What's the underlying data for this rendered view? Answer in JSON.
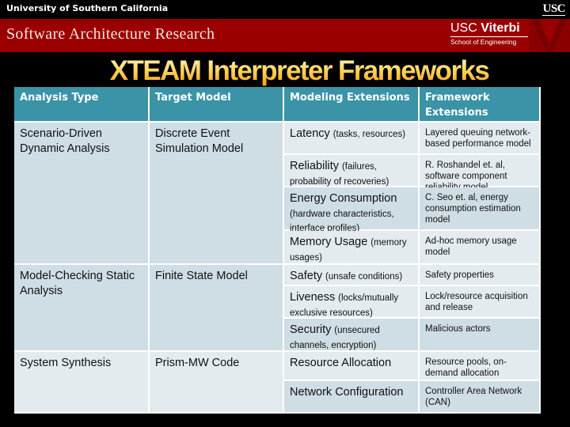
{
  "header": {
    "university": "University of Southern California",
    "usc_logo": "USC",
    "banner_title": "Software Architecture Research",
    "viterbi_line1_usc": "USC",
    "viterbi_line1_name": "Viterbi",
    "viterbi_line2": "School of Engineering"
  },
  "slide": {
    "title": "XTEAM Interpreter Frameworks"
  },
  "table": {
    "headers": [
      "Analysis Type",
      "Target Model",
      "Modeling Extensions",
      "Framework Extensions"
    ],
    "groups": [
      {
        "analysis_type": "Scenario-Driven Dynamic Analysis",
        "target_model": "Discrete Event Simulation Model",
        "rows": [
          {
            "ext_main": "Latency",
            "ext_detail": "(tasks, resources)",
            "framework": "Layered queuing network-based performance model"
          },
          {
            "ext_main": "Reliability",
            "ext_detail": "(failures, probability of recoveries)",
            "framework": "R. Roshandel et. al, software component reliability model"
          },
          {
            "ext_main": "Energy Consumption",
            "ext_detail": "(hardware characteristics, interface profiles)",
            "framework": "C. Seo et. al, energy consumption estimation model"
          },
          {
            "ext_main": "Memory Usage",
            "ext_detail": "(memory usages)",
            "framework": "Ad-hoc memory usage model"
          }
        ]
      },
      {
        "analysis_type": "Model-Checking Static Analysis",
        "target_model": "Finite State Model",
        "rows": [
          {
            "ext_main": "Safety",
            "ext_detail": "(unsafe conditions)",
            "framework": "Safety properties"
          },
          {
            "ext_main": "Liveness",
            "ext_detail": "(locks/mutually exclusive resources)",
            "framework": "Lock/resource acquisition and release"
          },
          {
            "ext_main": "Security",
            "ext_detail": "(unsecured channels, encryption)",
            "framework": "Malicious actors"
          }
        ]
      },
      {
        "analysis_type": "System Synthesis",
        "target_model": "Prism-MW Code",
        "rows": [
          {
            "ext_main": "Resource Allocation",
            "ext_detail": "",
            "framework": "Resource pools, on-demand allocation"
          },
          {
            "ext_main": "Network Configuration",
            "ext_detail": "",
            "framework": "Controller Area Network (CAN)"
          }
        ]
      }
    ]
  },
  "colors": {
    "banner": "#9b0000",
    "header_row": "#3a93a6",
    "row_dark": "#cfdde4",
    "row_light": "#e3ebef"
  }
}
